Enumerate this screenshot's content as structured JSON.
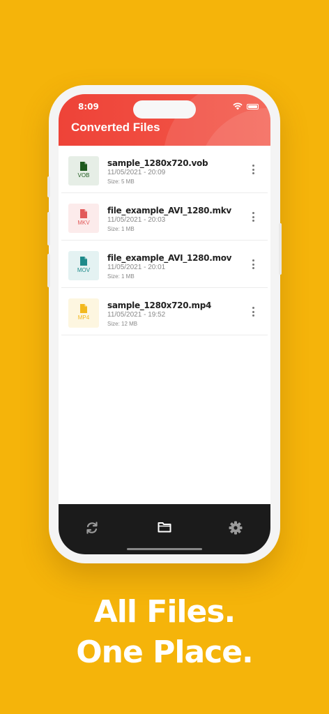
{
  "status_bar": {
    "time": "8:09"
  },
  "header": {
    "title": "Converted Files"
  },
  "files": [
    {
      "name": "sample_1280x720.vob",
      "date": "11/05/2021 - 20:09",
      "size": "Size: 5 MB",
      "ext": "VOB",
      "bg": "#E6EEE6",
      "color": "#1E5A1E"
    },
    {
      "name": "file_example_AVI_1280.mkv",
      "date": "11/05/2021 - 20:03",
      "size": "Size: 1 MB",
      "ext": "MKV",
      "bg": "#FCEBEB",
      "color": "#E25B5B"
    },
    {
      "name": "file_example_AVI_1280.mov",
      "date": "11/05/2021 - 20:01",
      "size": "Size: 1 MB",
      "ext": "MOV",
      "bg": "#E4F2F2",
      "color": "#1E8A8A"
    },
    {
      "name": "sample_1280x720.mp4",
      "date": "11/05/2021 - 19:52",
      "size": "Size: 12 MB",
      "ext": "MP4",
      "bg": "#FDF6E0",
      "color": "#F2B81E"
    }
  ],
  "navbar": {
    "items": [
      "refresh-icon",
      "folder-icon",
      "gear-icon"
    ]
  },
  "tagline": {
    "line1": "All Files.",
    "line2": "One Place."
  },
  "colors": {
    "background": "#F5B40A",
    "header": "#EE4338",
    "navbar": "#1B1B1B"
  }
}
